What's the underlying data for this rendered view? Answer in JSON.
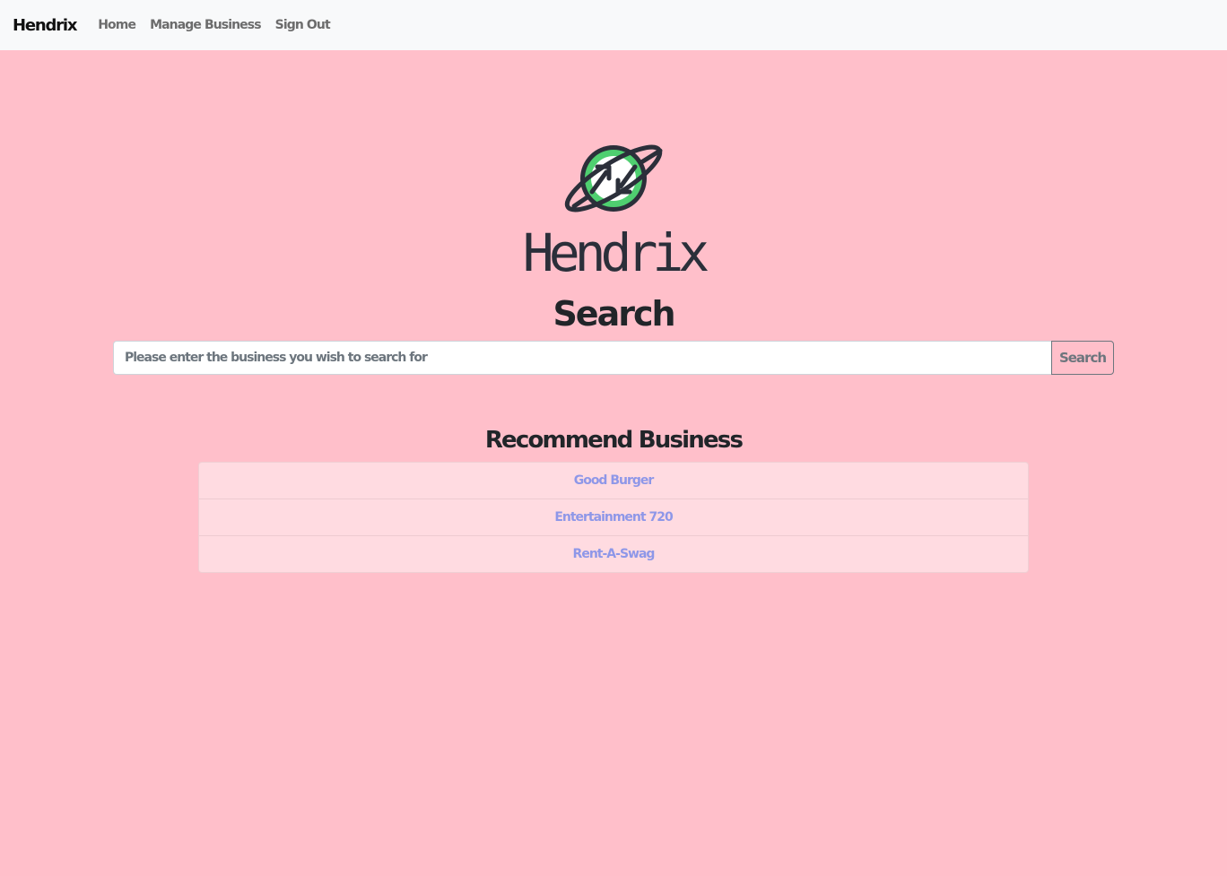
{
  "navbar": {
    "brand": "Hendrix",
    "links": [
      {
        "label": "Home"
      },
      {
        "label": "Manage Business"
      },
      {
        "label": "Sign Out"
      }
    ]
  },
  "hero": {
    "logo_icon": "planet-arrows-icon",
    "logo_text": "Hendrix",
    "title": "Search"
  },
  "search": {
    "placeholder": "Please enter the business you wish to search for",
    "value": "",
    "button_label": "Search"
  },
  "recommendations": {
    "title": "Recommend Business",
    "items": [
      {
        "label": "Good Burger"
      },
      {
        "label": "Entertainment 720"
      },
      {
        "label": "Rent-A-Swag"
      }
    ]
  },
  "colors": {
    "page_background": "#ffbfca",
    "navbar_background": "#f8f9fa",
    "list_background": "#ffdbe1",
    "link_color": "#8e97e8",
    "logo_green": "#4fcf70",
    "logo_dark": "#2b2f3a"
  }
}
